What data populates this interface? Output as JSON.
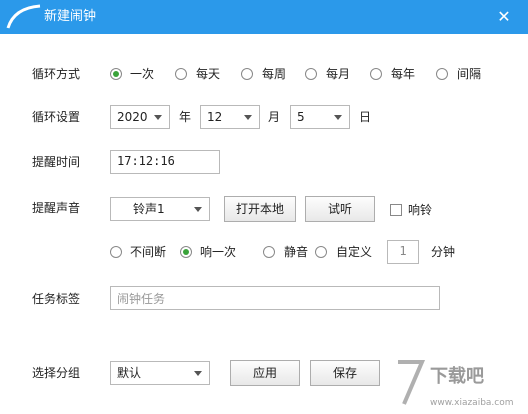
{
  "window": {
    "title": "新建闹钟",
    "close_symbol": "✕"
  },
  "loop_mode": {
    "label": "循环方式",
    "options": [
      "一次",
      "每天",
      "每周",
      "每月",
      "每年",
      "间隔"
    ],
    "selected": "一次"
  },
  "loop_setting": {
    "label": "循环设置",
    "year": "2020",
    "year_unit": "年",
    "month": "12",
    "month_unit": "月",
    "day": "5",
    "day_unit": "日"
  },
  "remind_time": {
    "label": "提醒时间",
    "value": "17:12:16"
  },
  "remind_sound": {
    "label": "提醒声音",
    "selected_sound": "铃声1",
    "open_local_label": "打开本地",
    "test_label": "试听",
    "ring_label": "响铃",
    "ring_checked": false,
    "repeat_options": [
      "不间断",
      "响一次",
      "静音",
      "自定义"
    ],
    "repeat_selected": "响一次",
    "custom_value": "1",
    "custom_unit": "分钟"
  },
  "task_tag": {
    "label": "任务标签",
    "placeholder": "闹钟任务"
  },
  "group": {
    "label": "选择分组",
    "selected": "默认",
    "apply_label": "应用",
    "save_label": "保存"
  },
  "watermark": {
    "text": "下载吧",
    "site": "www.xiazaiba.com"
  },
  "colors": {
    "titlebar": "#2b99ea",
    "radio_checked": "#3aa33a"
  }
}
